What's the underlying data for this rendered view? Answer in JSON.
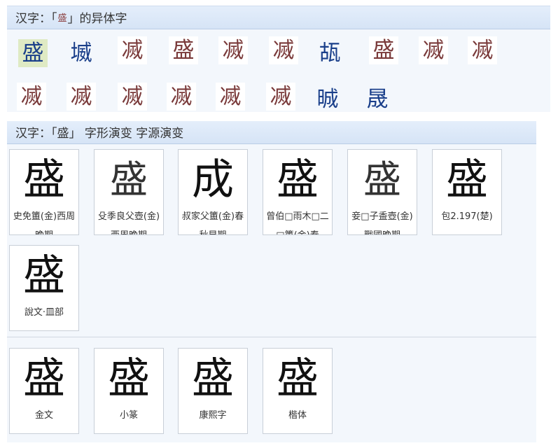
{
  "variants": {
    "title_prefix": "汉字：「",
    "title_glyph": "盛",
    "title_suffix": "」的异体字",
    "chars": [
      "盛",
      "㙎",
      "㓕",
      "盛",
      "㓕",
      "㓕",
      "瓳",
      "盛",
      "㓕",
      "㓕",
      "㓕",
      "㓕",
      "㓕",
      "㓕",
      "㓕",
      "㓕",
      "晠",
      "晟"
    ]
  },
  "evolution": {
    "title": "汉字：「盛」 字形演变 字源演变",
    "cards": [
      {
        "glyph": "盛",
        "caption": "史免簠(金)西周晚期"
      },
      {
        "glyph": "盛",
        "caption": "殳季良父壺(金)西周晚期"
      },
      {
        "glyph": "成",
        "caption": "叔家父簠(金)春秋早期"
      },
      {
        "glyph": "盛",
        "caption": "曾伯□雨木□二□簠(金)春"
      },
      {
        "glyph": "盛",
        "caption": "妾□子盉壺(金)戰國晚期"
      },
      {
        "glyph": "盛",
        "caption": "包2.197(楚)"
      },
      {
        "glyph": "盛",
        "caption": "說文‧皿部"
      }
    ],
    "forms": [
      {
        "glyph": "盛",
        "caption": "金文"
      },
      {
        "glyph": "盛",
        "caption": "小篆"
      },
      {
        "glyph": "盛",
        "caption": "康熙字"
      },
      {
        "glyph": "盛",
        "caption": "楷体"
      }
    ]
  },
  "colors": {
    "header_bg": "#d6e4f6",
    "panel_bg": "#f3f7fc",
    "variant_red": "#7a3a3a",
    "variant_blue": "#1a3f8a",
    "selected_bg": "#dfeac4"
  }
}
